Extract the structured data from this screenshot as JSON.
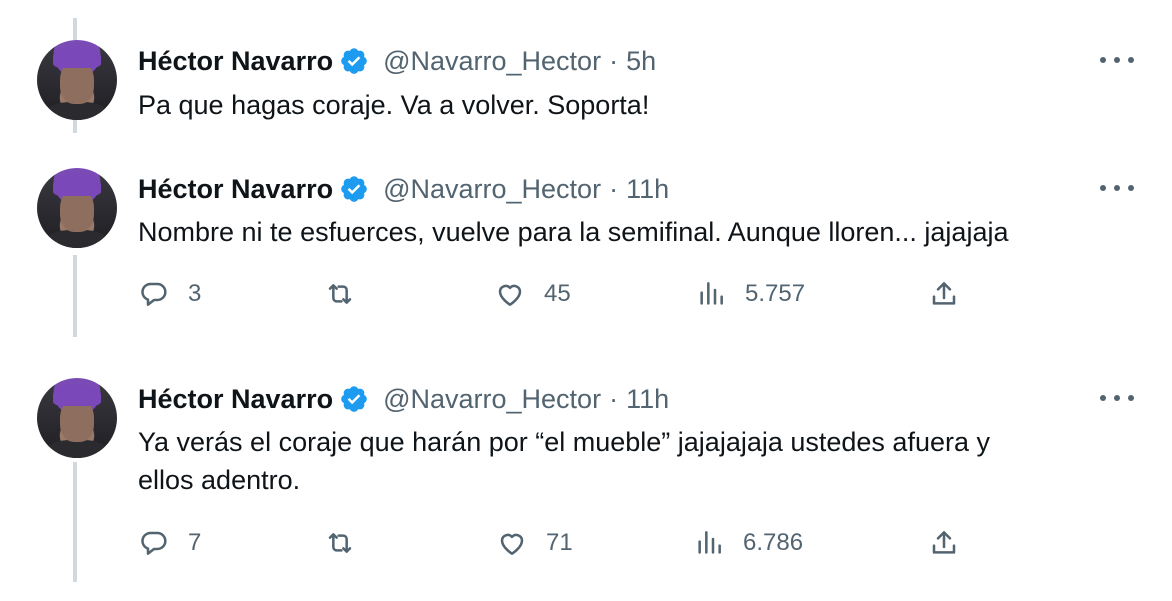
{
  "tweets": [
    {
      "name": "Héctor Navarro",
      "handle": "@Navarro_Hector",
      "dot": "·",
      "time": "5h",
      "text": "Pa que hagas coraje. Va a volver. Soporta!"
    },
    {
      "name": "Héctor Navarro",
      "handle": "@Navarro_Hector",
      "dot": "·",
      "time": "11h",
      "text": "Nombre ni te esfuerces, vuelve para la semifinal. Aunque lloren... jajajaja",
      "replies": "3",
      "retweets": "",
      "likes": "45",
      "views": "5.757"
    },
    {
      "name": "Héctor Navarro",
      "handle": "@Navarro_Hector",
      "dot": "·",
      "time": "11h",
      "text_line1": "Ya verás el coraje que harán por “el mueble” jajajajaja ustedes afuera y",
      "text_line2": "ellos adentro.",
      "replies": "7",
      "retweets": "",
      "likes": "71",
      "views": "6.786"
    }
  ],
  "colors": {
    "text": "#0f1419",
    "secondary": "#536471",
    "verified": "#1d9bf0",
    "thread_line": "#cfd9de",
    "avatar_hair": "#7a48b8"
  },
  "icons": [
    "verified-badge-icon",
    "more-icon",
    "reply-icon",
    "retweet-icon",
    "like-icon",
    "views-icon",
    "share-icon"
  ]
}
